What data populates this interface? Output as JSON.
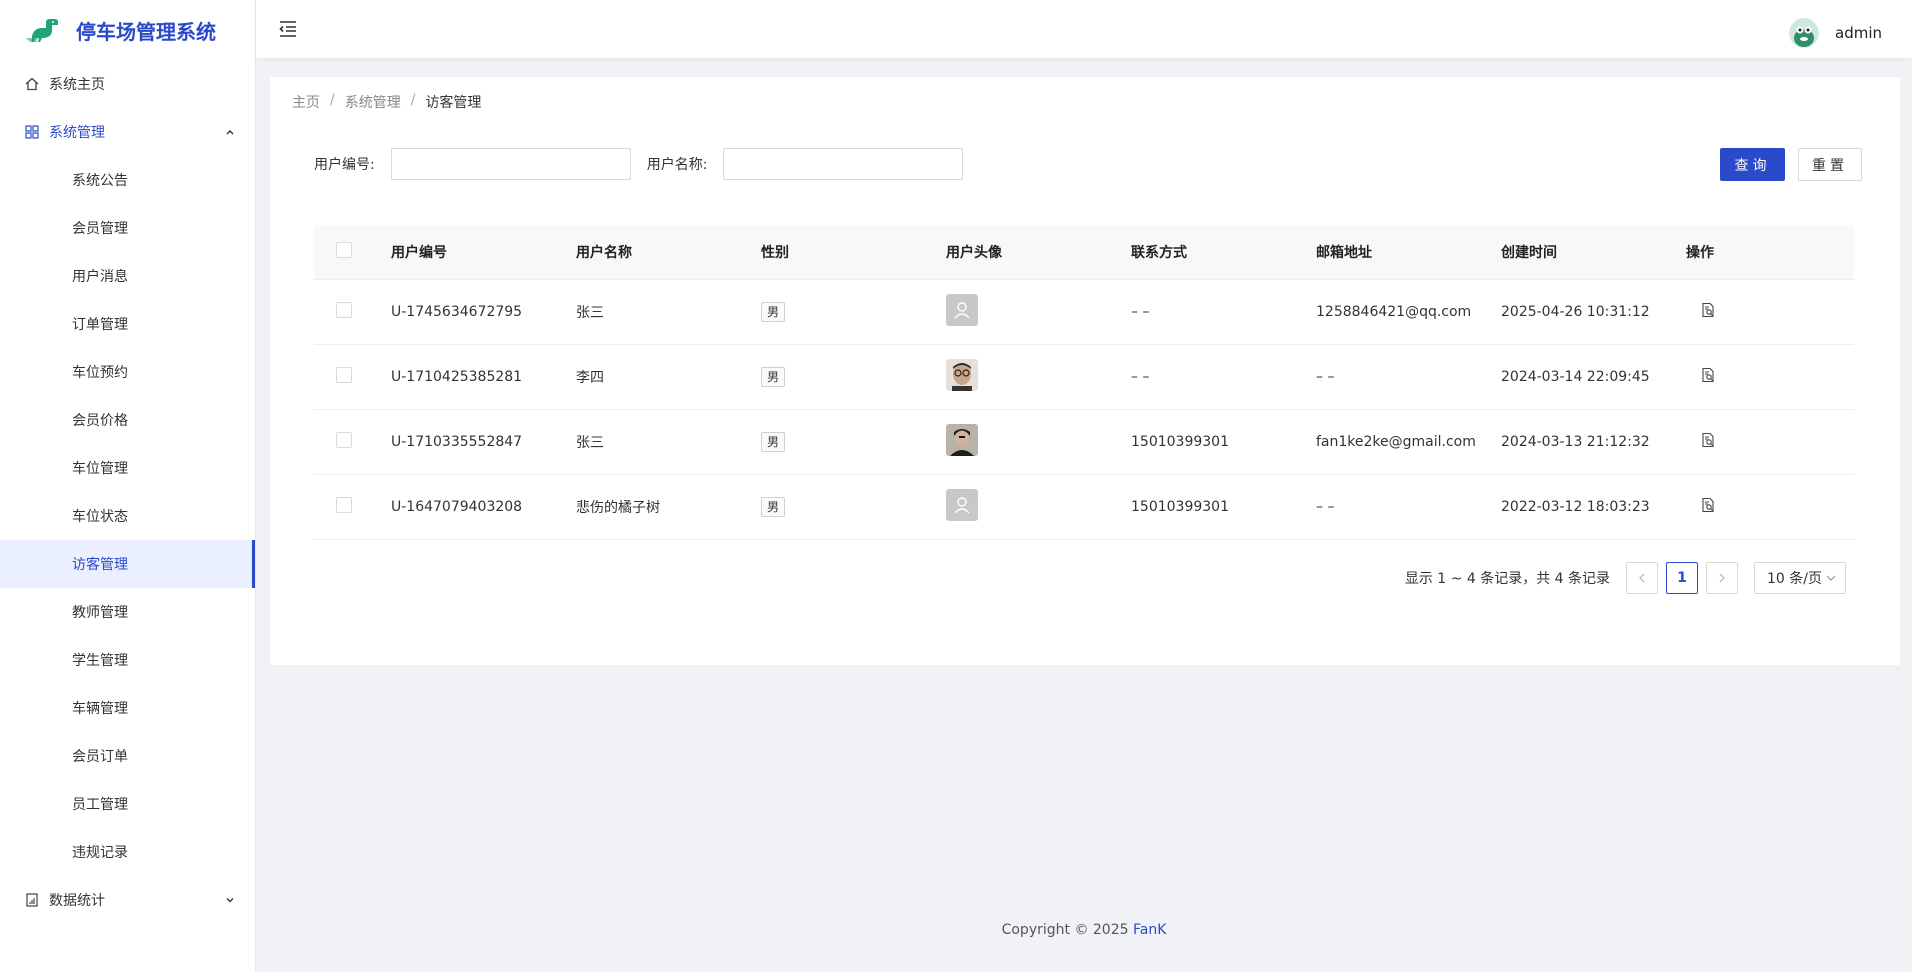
{
  "app": {
    "title": "停车场管理系统"
  },
  "sidebar": {
    "home": "系统主页",
    "group_system": "系统管理",
    "items": [
      "系统公告",
      "会员管理",
      "用户消息",
      "订单管理",
      "车位预约",
      "会员价格",
      "车位管理",
      "车位状态",
      "访客管理",
      "教师管理",
      "学生管理",
      "车辆管理",
      "会员订单",
      "员工管理",
      "违规记录"
    ],
    "active_item": "访客管理",
    "group_stats": "数据统计"
  },
  "header": {
    "user": "admin"
  },
  "breadcrumb": {
    "home": "主页",
    "parent": "系统管理",
    "current": "访客管理"
  },
  "search": {
    "user_id_label": "用户编号:",
    "user_id_value": "",
    "user_name_label": "用户名称:",
    "user_name_value": "",
    "query_button": "查询",
    "reset_button": "重置"
  },
  "table": {
    "columns": [
      "用户编号",
      "用户名称",
      "性别",
      "用户头像",
      "联系方式",
      "邮箱地址",
      "创建时间",
      "操作"
    ],
    "rows": [
      {
        "id": "U-1745634672795",
        "name": "张三",
        "gender": "男",
        "avatar": "placeholder",
        "phone": "– –",
        "email": "1258846421@qq.com",
        "created": "2025-04-26 10:31:12"
      },
      {
        "id": "U-1710425385281",
        "name": "李四",
        "gender": "男",
        "avatar": "photo-glasses",
        "phone": "– –",
        "email": "– –",
        "created": "2024-03-14 22:09:45"
      },
      {
        "id": "U-1710335552847",
        "name": "张三",
        "gender": "男",
        "avatar": "photo-dark",
        "phone": "15010399301",
        "email": "fan1ke2ke@gmail.com",
        "created": "2024-03-13 21:12:32"
      },
      {
        "id": "U-1647079403208",
        "name": "悲伤的橘子树",
        "gender": "男",
        "avatar": "placeholder",
        "phone": "15010399301",
        "email": "– –",
        "created": "2022-03-12 18:03:23"
      }
    ]
  },
  "pagination": {
    "summary": "显示 1 ~ 4 条记录，共 4 条记录",
    "current_page": "1",
    "page_size": "10 条/页"
  },
  "footer": {
    "text": "Copyright © 2025 ",
    "author": "FanK"
  },
  "colors": {
    "primary": "#2b4acb",
    "background": "#f0f2f5"
  }
}
